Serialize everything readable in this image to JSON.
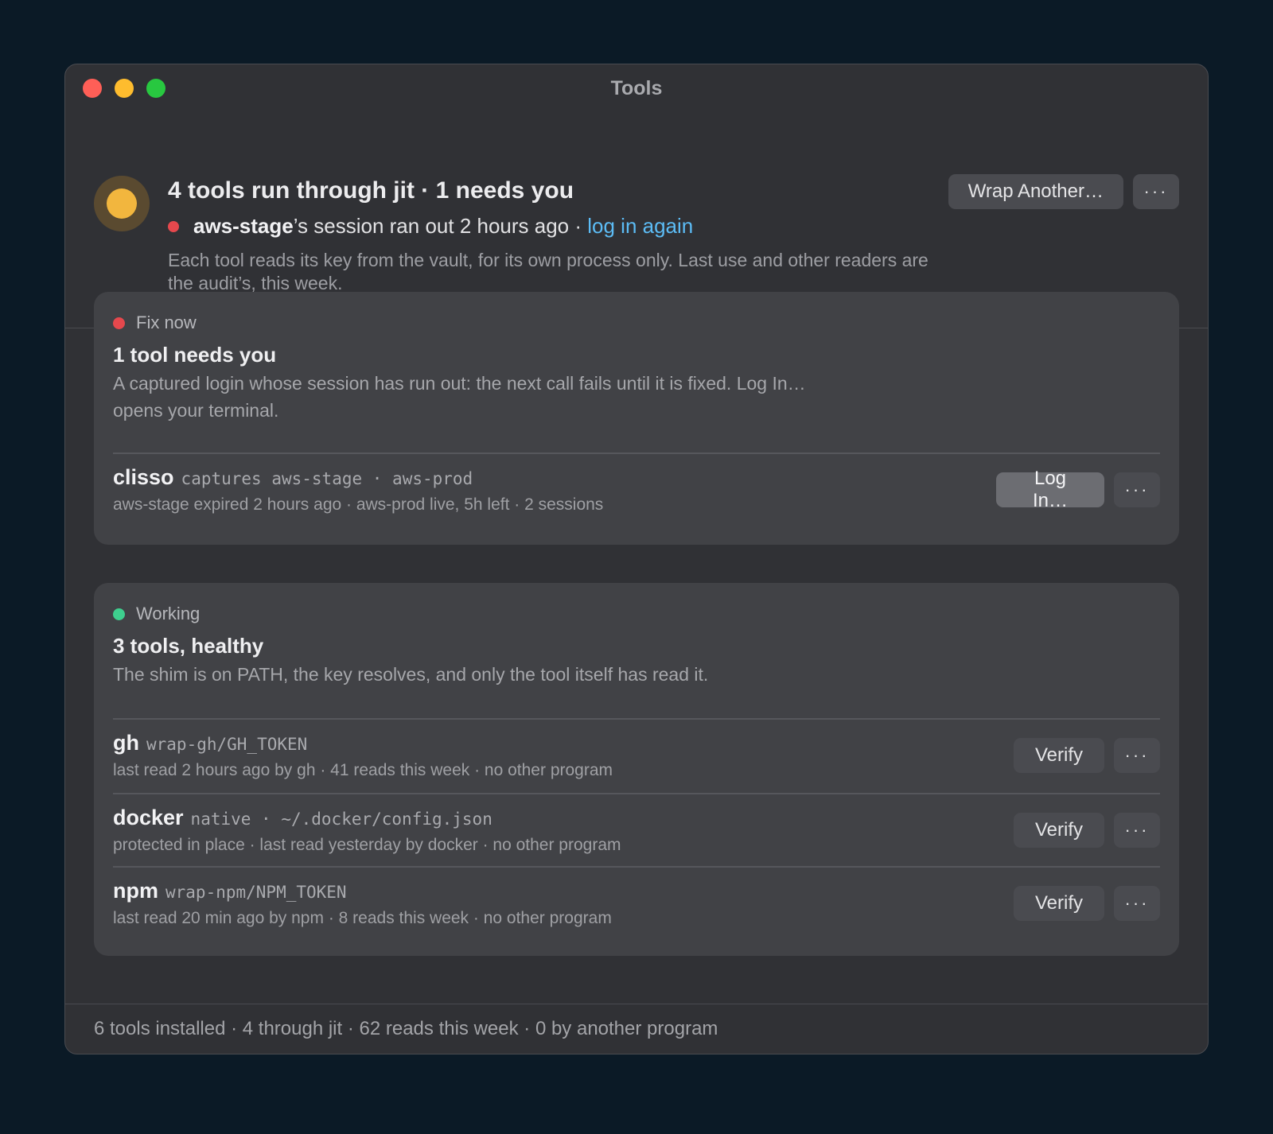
{
  "window": {
    "title": "Tools",
    "traffic_lights": {
      "close": "#ff5f57",
      "minimize": "#febc2e",
      "zoom": "#28c840"
    }
  },
  "header": {
    "title": "4 tools run through jit · 1 needs you",
    "alert": {
      "tool": "aws-stage",
      "text": "’s session ran out 2 hours ago · ",
      "link": "log in again"
    },
    "description": "Each tool reads its key from the vault, for its own process only. Last use and other readers are the audit’s, this week.",
    "actions": {
      "wrap_label": "Wrap Another…",
      "more_label": "···"
    }
  },
  "sections": [
    {
      "label": "Fix now",
      "status_color": "#e5484d",
      "title": "1 tool needs you",
      "description": "A captured login whose session has run out: the next call fails until it is fixed. Log In… opens your terminal.",
      "rows": [
        {
          "name": "clisso",
          "detail": "captures aws-stage · aws-prod",
          "meta": "aws-stage expired 2 hours ago · aws-prod live, 5h left · 2 sessions",
          "action_label": "Log In…",
          "more_label": "···"
        }
      ]
    },
    {
      "label": "Working",
      "status_color": "#3ecf8e",
      "title": "3 tools, healthy",
      "description": "The shim is on PATH, the key resolves, and only the tool itself has read it.",
      "rows": [
        {
          "name": "gh",
          "detail": "wrap-gh/GH_TOKEN",
          "meta": "last read 2 hours ago by gh · 41 reads this week · no other program",
          "action_label": "Verify",
          "more_label": "···"
        },
        {
          "name": "docker",
          "detail": "native · ~/.docker/config.json",
          "meta": "protected in place · last read yesterday by docker · no other program",
          "action_label": "Verify",
          "more_label": "···"
        },
        {
          "name": "npm",
          "detail": "wrap-npm/NPM_TOKEN",
          "meta": "last read 20 min ago by npm · 8 reads this week · no other program",
          "action_label": "Verify",
          "more_label": "···"
        }
      ]
    }
  ],
  "footer": {
    "summary": "6 tools installed · 4 through jit · 62 reads this week · 0 by another program"
  }
}
